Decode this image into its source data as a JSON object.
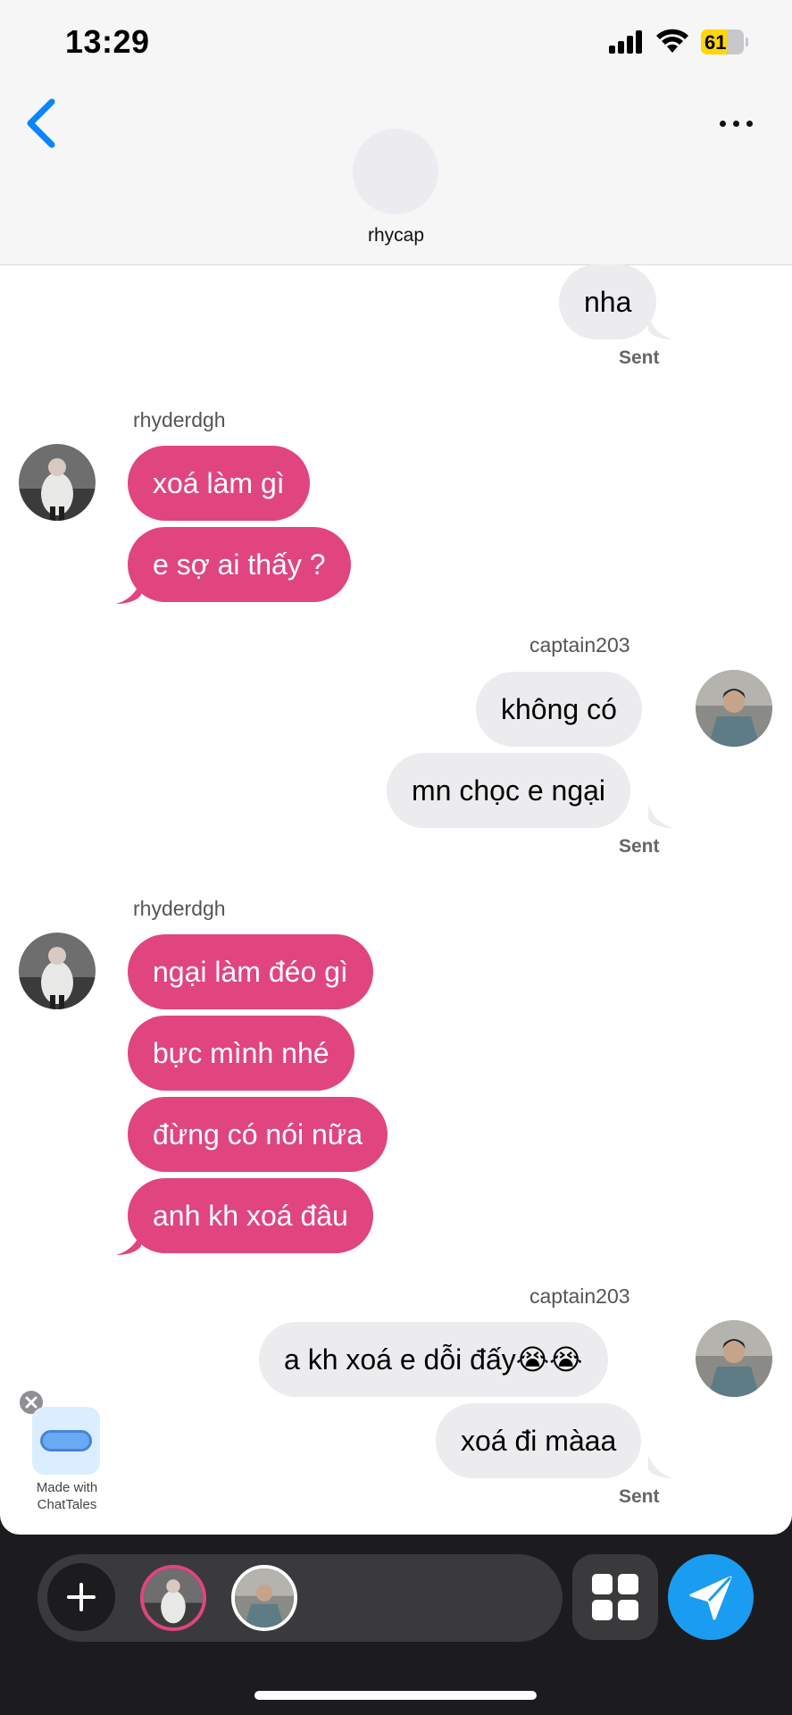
{
  "status": {
    "time": "13:29",
    "battery": "61",
    "battery_level": 0.61
  },
  "header": {
    "contact_name": "rhycap"
  },
  "messages": {
    "m1": "nha",
    "sent1": "Sent",
    "sender_a1": "rhyderdgh",
    "m2": "xoá làm gì",
    "m3": "e sợ ai thấy ?",
    "sender_b1": "captain203",
    "m4": "không có",
    "m5": "mn chọc e ngại",
    "sent2": "Sent",
    "sender_a2": "rhyderdgh",
    "m6": "ngại làm đéo gì",
    "m7": "bực mình nhé",
    "m8": "đừng có nói nữa",
    "m9": "anh kh xoá đâu",
    "sender_b2": "captain203",
    "m10": "a kh xoá e dỗi đấy😭😭",
    "m11": "xoá đi màaa",
    "sent3": "Sent"
  },
  "watermark": {
    "line1": "Made with",
    "line2": "ChatTales"
  },
  "colors": {
    "incoming_bubble": "#e0457f",
    "outgoing_bubble": "#ececef",
    "send_button": "#1a9df0",
    "back_arrow": "#0a84ff"
  }
}
